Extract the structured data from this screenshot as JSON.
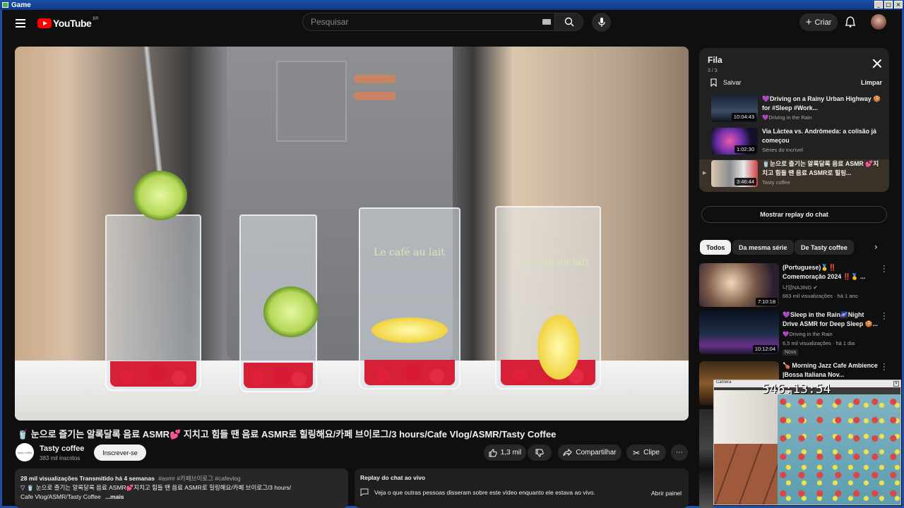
{
  "window": {
    "title": "Game"
  },
  "header": {
    "logo_text": "YouTube",
    "region": "BR",
    "search_placeholder": "Pesquisar",
    "create_label": "Criar"
  },
  "video": {
    "title": "🥤 눈으로 즐기는 알록달록 음료 ASMR💕 지치고 힘들 땐 음료 ASMR로 힐링해요/카페 브이로그/3 hours/Cafe Vlog/ASMR/Tasty Coffee",
    "glass_text": "Le café au lait",
    "channel_name": "Tasty coffee",
    "channel_avatar_text": "tasty coffee",
    "subscribers": "383 mil inscritos",
    "subscribe_label": "Inscrever-se",
    "likes": "1,3 mil",
    "share_label": "Compartilhar",
    "clip_label": "Clipe",
    "more_label": "⋯"
  },
  "description": {
    "meta": "28 mil visualizações  Transmitido há 4 semanas",
    "tags": "#asmr #카페브이로그 #cafevlog",
    "line2": "▽ 🥤 눈으로 즐기는 알록달록 음료 ASMR💕지치고 힘들 땐 음료 ASMR로 힐링해요/카페 브이로그/3 hours/",
    "line3": "Cafe Vlog/ASMR/Tasty Coffee",
    "more": "...mais"
  },
  "chat_replay": {
    "heading": "Replay do chat ao vivo",
    "text": "Veja o que outras pessoas disseram sobre este vídeo enquanto ele estava ao vivo.",
    "open_label": "Abrir painel",
    "show_replay": "Mostrar replay do chat"
  },
  "queue": {
    "title": "Fila",
    "count": "3 / 3",
    "save_label": "Salvar",
    "clear_label": "Limpar",
    "items": [
      {
        "title": "💜Driving on a Rainy Urban Highway 🍪 for #Sleep #Work...",
        "channel": "💜Driving in the Rain",
        "duration": "10:04:43"
      },
      {
        "title": "Via Láctea vs. Andrômeda: a colisão já começou",
        "channel": "Séries do Incrível",
        "duration": "1:02:30"
      },
      {
        "title": "🥤눈으로 즐기는 알록달록 음료 ASMR 💕지치고 힘들 땐 음료 ASMR로 힐링...",
        "channel": "Tasty coffee",
        "duration": "3:46:44"
      }
    ]
  },
  "chips": [
    "Todos",
    "Da mesma série",
    "De Tasty coffee"
  ],
  "recommendations": [
    {
      "title": "(Portuguese)🥇‼️ Comemoração 2024 ‼️🥇 ...",
      "channel": "나잉NAJING ✔",
      "stats": "663 mil visualizações · há 1 ano",
      "duration": "7:10:18",
      "badge": ""
    },
    {
      "title": "💜Sleep in the Rain🌌Night Drive ASMR for Deep Sleep 🍪...",
      "channel": "💜Driving in the Rain",
      "stats": "6,5 mil visualizações · há 1 dia",
      "duration": "10:12:04",
      "badge": "Novo"
    },
    {
      "title": "🍗 Morning Jazz Cafe Ambience |Bossa Italiana Nov...",
      "channel": "",
      "stats": "",
      "duration": "",
      "badge": ""
    }
  ],
  "webcam": {
    "timer": "546:13:54",
    "title": "Caméra"
  },
  "colors": {
    "accent": "#ff0000",
    "bg": "#0f0f0f",
    "surface": "#272727"
  }
}
